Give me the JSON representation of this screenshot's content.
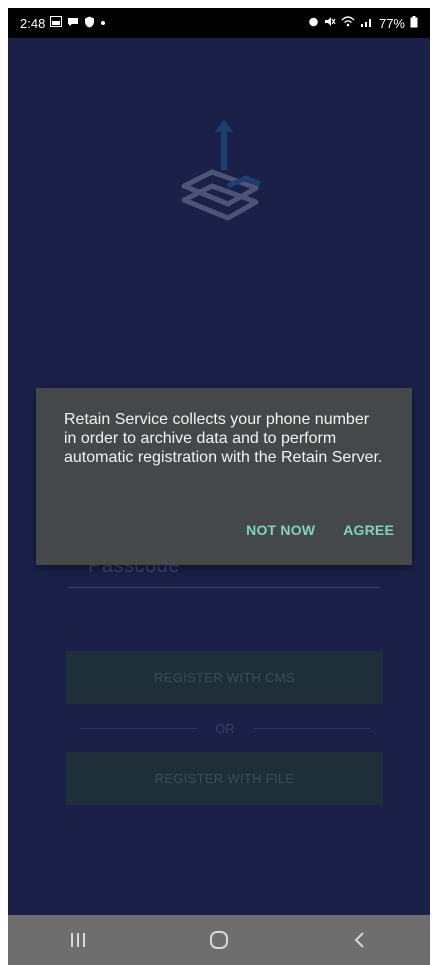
{
  "status_bar": {
    "time": "2:48",
    "battery": "77%"
  },
  "passcode": {
    "placeholder": "Passcode"
  },
  "buttons": {
    "register_cms": "REGISTER WITH CMS",
    "or": "OR",
    "register_file": "REGISTER WITH FILE"
  },
  "dialog": {
    "message": "Retain Service collects your phone number in order to archive data and to perform automatic registration with the Retain Server.",
    "not_now": "NOT NOW",
    "agree": "AGREE"
  },
  "colors": {
    "background": "#1b2048",
    "dialog": "#454848",
    "accent": "#7fd3c4"
  },
  "icons": {
    "logo": "retain-logo-icon",
    "nav_recents": "recents-icon",
    "nav_home": "home-icon",
    "nav_back": "back-icon"
  }
}
